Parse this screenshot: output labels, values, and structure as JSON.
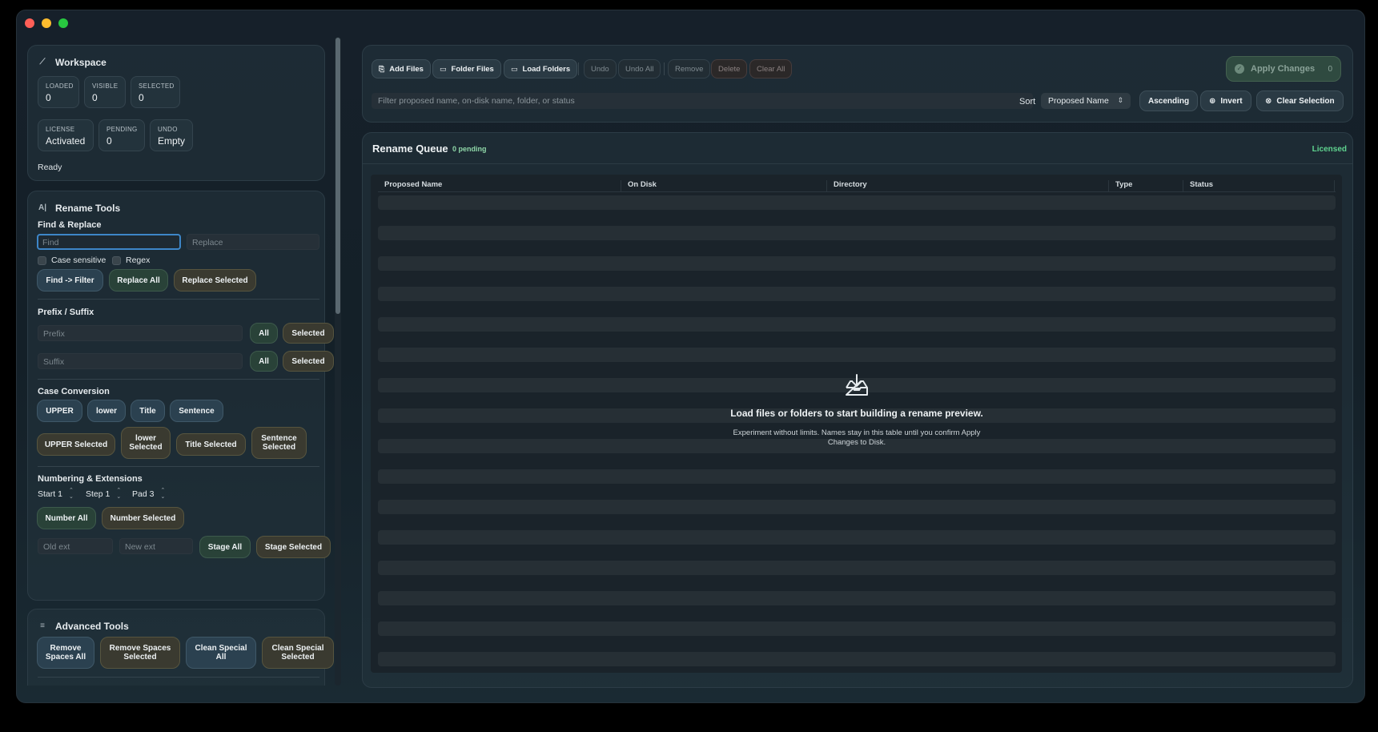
{
  "workspace": {
    "title": "Workspace",
    "stats": [
      {
        "key": "LOADED",
        "value": "0"
      },
      {
        "key": "VISIBLE",
        "value": "0"
      },
      {
        "key": "SELECTED",
        "value": "0"
      },
      {
        "key": "LICENSE",
        "value": "Activated"
      },
      {
        "key": "PENDING",
        "value": "0"
      },
      {
        "key": "UNDO",
        "value": "Empty"
      }
    ],
    "status": "Ready"
  },
  "rename_tools": {
    "title": "Rename Tools",
    "find_replace": {
      "title": "Find & Replace",
      "find_placeholder": "Find",
      "replace_placeholder": "Replace",
      "case_sensitive": "Case sensitive",
      "regex": "Regex",
      "find_filter": "Find -> Filter",
      "replace_all": "Replace All",
      "replace_selected": "Replace Selected"
    },
    "prefix_suffix": {
      "title": "Prefix / Suffix",
      "prefix_placeholder": "Prefix",
      "suffix_placeholder": "Suffix",
      "all": "All",
      "selected": "Selected"
    },
    "case_conversion": {
      "title": "Case Conversion",
      "upper": "UPPER",
      "lower": "lower",
      "title_case": "Title",
      "sentence": "Sentence",
      "upper_selected": "UPPER Selected",
      "lower_selected": "lower Selected",
      "title_selected": "Title Selected",
      "sentence_selected": "Sentence Selected"
    },
    "numbering": {
      "title": "Numbering & Extensions",
      "start": "Start 1",
      "step": "Step 1",
      "pad": "Pad 3",
      "number_all": "Number All",
      "number_selected": "Number Selected",
      "old_ext_placeholder": "Old ext",
      "new_ext_placeholder": "New ext",
      "stage_all": "Stage All",
      "stage_selected": "Stage Selected"
    }
  },
  "advanced_tools": {
    "title": "Advanced Tools",
    "remove_spaces_all": "Remove Spaces All",
    "remove_spaces_selected": "Remove Spaces Selected",
    "clean_special_all": "Clean Special All",
    "clean_special_selected": "Clean Special Selected"
  },
  "toolbar": {
    "add_files": "Add Files",
    "folder_files": "Folder Files",
    "load_folders": "Load Folders",
    "undo": "Undo",
    "undo_all": "Undo All",
    "remove": "Remove",
    "delete": "Delete",
    "clear_all": "Clear All",
    "apply_changes": "Apply Changes",
    "apply_count": "0",
    "filter_placeholder": "Filter proposed name, on-disk name, folder, or status",
    "sort_label": "Sort",
    "sort_value": "Proposed Name",
    "ascending": "Ascending",
    "invert": "Invert",
    "clear_selection": "Clear Selection"
  },
  "queue": {
    "title": "Rename Queue",
    "pending_badge": "0 pending",
    "license_status": "Licensed",
    "columns": [
      "Proposed Name",
      "On Disk",
      "Directory",
      "Type",
      "Status"
    ],
    "empty_title": "Load files or folders to start building a rename preview.",
    "empty_subtitle": "Experiment without limits. Names stay in this table until you confirm Apply Changes to Disk."
  }
}
